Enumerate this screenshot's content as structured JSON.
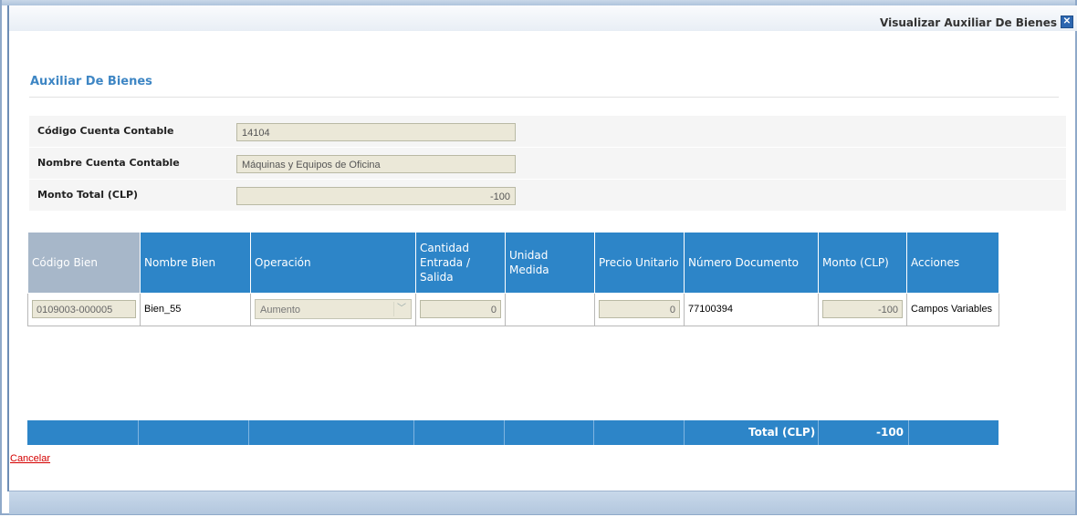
{
  "window": {
    "title": "Visualizar Auxiliar De Bienes",
    "close_icon": "close-icon"
  },
  "section": {
    "title": "Auxiliar De Bienes"
  },
  "form": {
    "codigo_label": "Código Cuenta Contable",
    "codigo_value": "14104",
    "nombre_label": "Nombre Cuenta Contable",
    "nombre_value": "Máquinas y Equipos de Oficina",
    "monto_label": "Monto Total (CLP)",
    "monto_value": "-100"
  },
  "table": {
    "headers": [
      "Código Bien",
      "Nombre Bien",
      "Operación",
      "Cantidad Entrada / Salida",
      "Unidad Medida",
      "Precio Unitario",
      "Número Documento",
      "Monto (CLP)",
      "Acciones"
    ],
    "rows": [
      {
        "codigo": "0109003-000005",
        "nombre": "Bien_55",
        "operacion": "Aumento",
        "cantidad": "0",
        "unidad": "",
        "precio": "0",
        "documento": "77100394",
        "monto": "-100",
        "acciones": "Campos Variables"
      }
    ]
  },
  "total": {
    "label": "Total (CLP)",
    "value": "-100"
  },
  "actions": {
    "cancel": "Cancelar"
  }
}
